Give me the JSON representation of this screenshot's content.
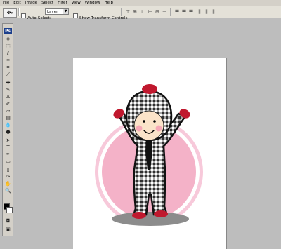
{
  "menubar": {
    "items": [
      {
        "label": "File"
      },
      {
        "label": "Edit"
      },
      {
        "label": "Image"
      },
      {
        "label": "Select"
      },
      {
        "label": "Filter"
      },
      {
        "label": "View"
      },
      {
        "label": "Window"
      },
      {
        "label": "Help"
      }
    ]
  },
  "options_bar": {
    "tool_preset_icon": "move-tool-icon",
    "auto_select_label": "Auto-Select:",
    "auto_select_checked": false,
    "auto_select_target": "Layer",
    "show_transform_label": "Show Transform Controls",
    "show_transform_checked": false
  },
  "toolbox": {
    "logo": "Ps",
    "foreground_color": "#000000",
    "background_color": "#ffffff"
  },
  "artwork": {
    "colors": {
      "circle": "#f4b2c8",
      "ring": "#f7c9da",
      "shadow": "#8c8c8c",
      "red": "#c0182e",
      "skin": "#fbe3c9",
      "cheeks": "#f6a8b6",
      "plaid": "#4a4a4a"
    }
  }
}
